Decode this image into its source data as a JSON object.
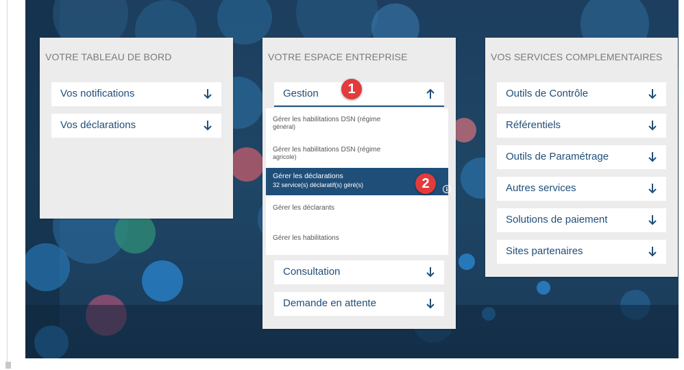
{
  "colors": {
    "accent": "#1f4e79",
    "panel_bg": "#ececec",
    "badge": "#e23b3b",
    "hero_bg": "#1f4666"
  },
  "tableau": {
    "title": "VOTRE TABLEAU DE BORD",
    "items": [
      {
        "label": "Vos notifications",
        "icon": "arrow-down-icon"
      },
      {
        "label": "Vos déclarations",
        "icon": "arrow-down-icon"
      }
    ]
  },
  "espace": {
    "title": "VOTRE ESPACE ENTREPRISE",
    "gestion": {
      "label": "Gestion",
      "icon": "arrow-up-icon",
      "expanded": true
    },
    "submenu": [
      {
        "line1": "Gérer les habilitations DSN (régime",
        "line2": "général)"
      },
      {
        "line1": "Gérer les habilitations DSN (régime",
        "line2": "agricole)"
      },
      {
        "line1": "Gérer les déclarations",
        "line2": "32 service(s) déclaratif(s) géré(s)",
        "active": true
      },
      {
        "line1": "Gérer les déclarants"
      },
      {
        "line1": "Gérer les habilitations"
      }
    ],
    "items": [
      {
        "label": "Consultation",
        "icon": "arrow-down-icon"
      },
      {
        "label": "Demande en attente",
        "icon": "arrow-down-icon"
      }
    ]
  },
  "services": {
    "title": "VOS SERVICES COMPLEMENTAIRES",
    "items": [
      {
        "label": "Outils de Contrôle",
        "icon": "arrow-down-icon"
      },
      {
        "label": "Référentiels",
        "icon": "arrow-down-icon"
      },
      {
        "label": "Outils de Paramétrage",
        "icon": "arrow-down-icon"
      },
      {
        "label": "Autres services",
        "icon": "arrow-down-icon"
      },
      {
        "label": "Solutions de paiement",
        "icon": "arrow-down-icon"
      },
      {
        "label": "Sites partenaires",
        "icon": "arrow-down-icon"
      }
    ]
  },
  "annotations": {
    "badge1": "1",
    "badge2": "2",
    "info_glyph": "i"
  }
}
